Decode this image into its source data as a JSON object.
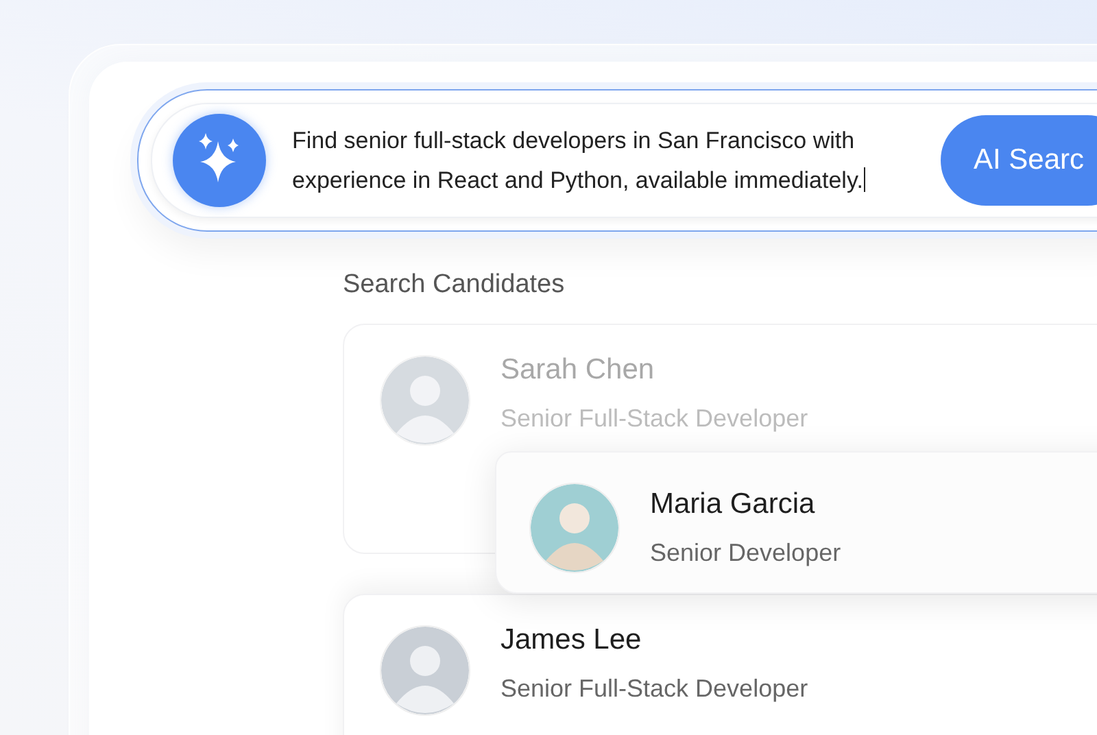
{
  "search": {
    "value": "Find senior full-stack developers in San Francisco with experience in React and Python, available immediately.",
    "button": "AI Searc"
  },
  "section_title": "Search Candidates",
  "candidates": [
    {
      "name": "Sarah Chen",
      "title": "Senior Full-Stack Developer",
      "dimmed": true,
      "raised": false
    },
    {
      "name": "Maria Garcia",
      "title": "Senior Developer",
      "dimmed": false,
      "raised": true
    },
    {
      "name": "James Lee",
      "title": "Senior Full-Stack Developer",
      "dimmed": false,
      "raised": false
    }
  ]
}
